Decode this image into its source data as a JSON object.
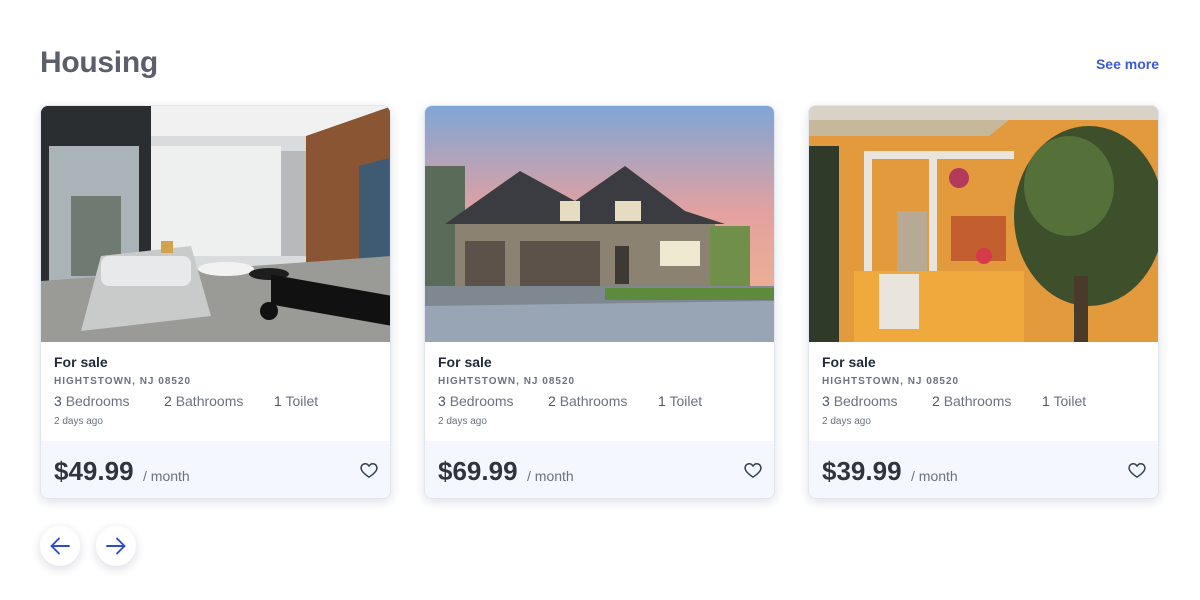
{
  "section": {
    "title": "Housing",
    "see_more_label": "See more"
  },
  "listings": [
    {
      "status": "For sale",
      "location": "HIGHTSTOWN, NJ 08520",
      "bedrooms": "3",
      "bedrooms_label": "Bedrooms",
      "bathrooms": "2",
      "bathrooms_label": "Bathrooms",
      "toilets": "1",
      "toilets_label": "Toilet",
      "posted": "2 days ago",
      "price": "$49.99",
      "period": "/ month",
      "image": "living-room-interior-photo"
    },
    {
      "status": "For sale",
      "location": "HIGHTSTOWN, NJ 08520",
      "bedrooms": "3",
      "bedrooms_label": "Bedrooms",
      "bathrooms": "2",
      "bathrooms_label": "Bathrooms",
      "toilets": "1",
      "toilets_label": "Toilet",
      "posted": "2 days ago",
      "price": "$69.99",
      "period": "/ month",
      "image": "suburban-house-exterior-photo"
    },
    {
      "status": "For sale",
      "location": "HIGHTSTOWN, NJ 08520",
      "bedrooms": "3",
      "bedrooms_label": "Bedrooms",
      "bathrooms": "2",
      "bathrooms_label": "Bathrooms",
      "toilets": "1",
      "toilets_label": "Toilet",
      "posted": "2 days ago",
      "price": "$39.99",
      "period": "/ month",
      "image": "orange-house-porch-photo"
    }
  ],
  "icons": {
    "favorite": "heart-outline-icon",
    "previous": "arrow-left-icon",
    "next": "arrow-right-icon"
  },
  "colors": {
    "accent": "#3b5bd8",
    "title": "#5b5f6b",
    "footer_bg": "#f4f7fd"
  }
}
